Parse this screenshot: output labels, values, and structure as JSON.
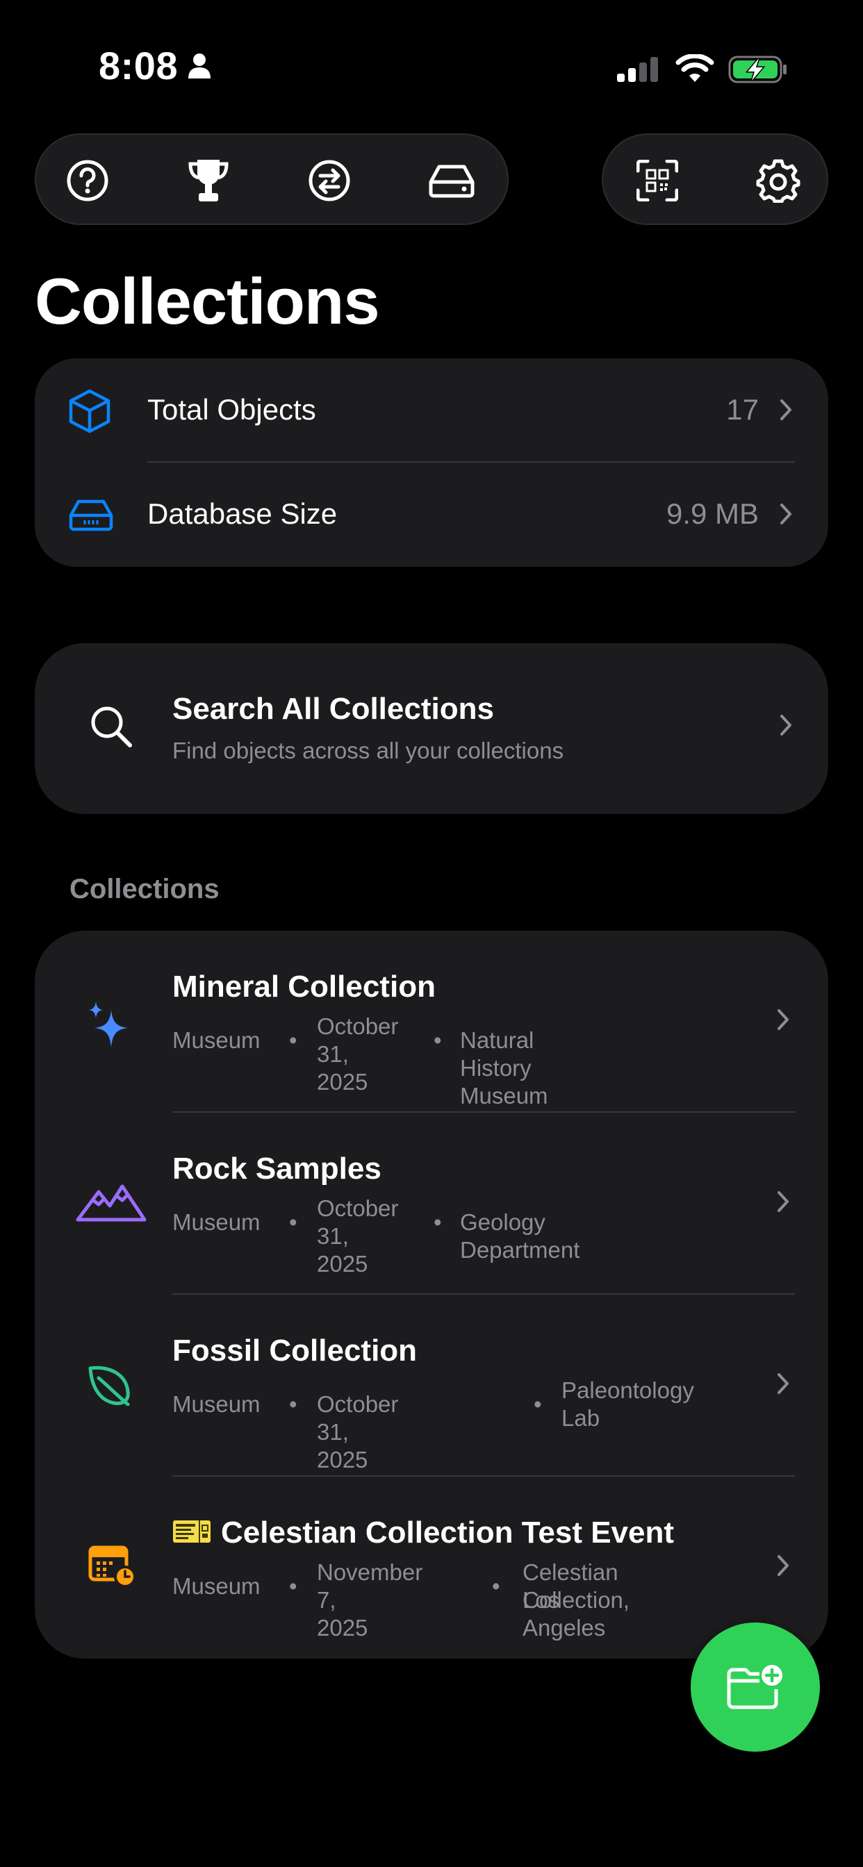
{
  "status_bar": {
    "time": "8:08"
  },
  "title": "Collections",
  "stats": [
    {
      "label": "Total Objects",
      "value": "17",
      "icon": "cube-icon"
    },
    {
      "label": "Database Size",
      "value": "9.9 MB",
      "icon": "drive-icon"
    }
  ],
  "search": {
    "title": "Search All Collections",
    "subtitle": "Find objects across all your collections"
  },
  "section_header": "Collections",
  "collections": [
    {
      "title": "Mineral Collection",
      "type": "Museum",
      "date_line1": "October",
      "date_line2": "31, 2025",
      "location_line1": "Natural History Museum",
      "location_line2": "",
      "icon": "sparkles-icon",
      "color": "#4a8cff"
    },
    {
      "title": "Rock Samples",
      "type": "Museum",
      "date_line1": "October",
      "date_line2": "31, 2025",
      "location_line1": "Geology Department",
      "location_line2": "",
      "icon": "mountains-icon",
      "color": "#9b6cff"
    },
    {
      "title": "Fossil Collection",
      "type": "Museum",
      "date_line1": "October 31, 2025",
      "date_line2": "",
      "location_line1": "Paleontology",
      "location_line2": "Lab",
      "icon": "leaf-icon",
      "color": "#30c48d"
    },
    {
      "title": "Celestian Collection Test Event",
      "type": "Museum",
      "date_line1": "November",
      "date_line2": "7, 2025",
      "location_line1": "Celestian Collection,",
      "location_line2": "Los Angeles",
      "icon": "calendar-clock-icon",
      "color": "#ff9f0a"
    }
  ],
  "colors": {
    "accent_blue": "#0a84ff",
    "card": "#1c1c1e",
    "secondary_text": "#8e8e93",
    "fab": "#30d158"
  }
}
